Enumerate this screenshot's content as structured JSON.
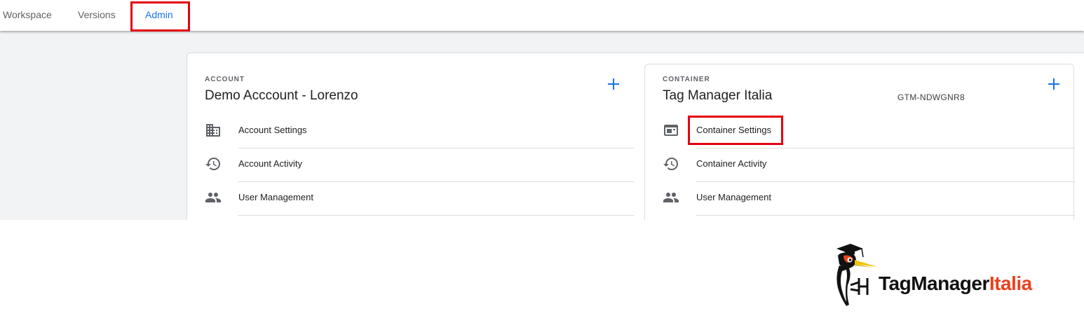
{
  "tabs": [
    {
      "label": "Workspace"
    },
    {
      "label": "Versions"
    },
    {
      "label": "Admin"
    }
  ],
  "account": {
    "section_label": "ACCOUNT",
    "name": "Demo Acccount - Lorenzo",
    "items": [
      {
        "label": "Account Settings",
        "icon": "building-icon"
      },
      {
        "label": "Account Activity",
        "icon": "history-icon"
      },
      {
        "label": "User Management",
        "icon": "people-icon"
      }
    ]
  },
  "container": {
    "section_label": "CONTAINER",
    "name": "Tag Manager Italia",
    "id": "GTM-NDWGNR8",
    "items": [
      {
        "label": "Container Settings",
        "icon": "container-icon"
      },
      {
        "label": "Container Activity",
        "icon": "history-icon"
      },
      {
        "label": "User Management",
        "icon": "people-icon"
      }
    ]
  },
  "brand": {
    "part1": "TagManager",
    "part2": "Italia"
  },
  "colors": {
    "accent": "#1a73e8",
    "highlight": "#e3000f",
    "brand_orange": "#e8421f"
  }
}
